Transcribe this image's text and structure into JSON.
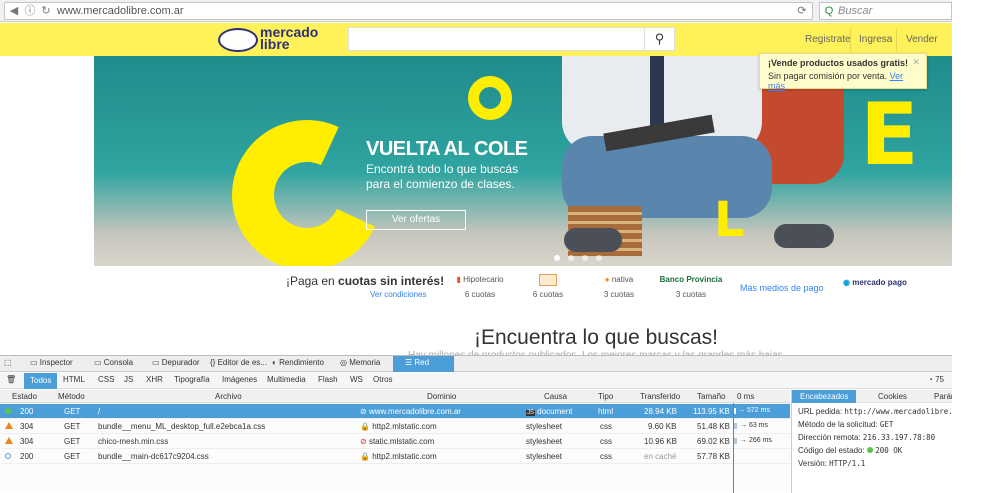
{
  "browser": {
    "url": "www.mercadolibre.com.ar",
    "search_placeholder": "Buscar"
  },
  "header": {
    "logo_line1": "mercado",
    "logo_line2": "libre",
    "links": [
      "Registrate",
      "Ingresa",
      "Vender"
    ]
  },
  "banner": {
    "title": "VUELTA AL COLE",
    "subtitle_line1": "Encontrá todo lo que buscás",
    "subtitle_line2": "para el comienzo de clases.",
    "button": "Ver ofertas"
  },
  "tooltip": {
    "title": "¡Vende productos usados gratis!",
    "text": "Sin pagar comisión por venta.",
    "link": "Ver más"
  },
  "payments": {
    "title_prefix": "¡Paga en ",
    "title_bold": "cuotas sin interés!",
    "link": "Ver condiciones",
    "banks": [
      {
        "name": "Hipotecario",
        "cuotas": "6 cuotas"
      },
      {
        "name": "",
        "cuotas": "6 cuotas"
      },
      {
        "name": "nativa",
        "cuotas": "3 cuotas"
      },
      {
        "name": "Banco Provincia",
        "cuotas": "3 cuotas"
      }
    ],
    "more": "Más medios de pago",
    "mpago": "mercado pago"
  },
  "section": {
    "title": "¡Encuentra lo que buscas!",
    "faded": "Hay millones de productos publicados. Los mejores marcas y las grandes más bajas"
  },
  "devtools": {
    "tabs": [
      "Inspector",
      "Consola",
      "Depurador",
      "Editor de es...",
      "Rendimiento",
      "Memoria",
      "Red"
    ],
    "filters": [
      "Todos",
      "HTML",
      "CSS",
      "JS",
      "XHR",
      "Tipografía",
      "Imágenes",
      "Multimedia",
      "Flash",
      "WS",
      "Otros"
    ],
    "request_count": "75",
    "columns": [
      "Estado",
      "Método",
      "Archivo",
      "Dominio",
      "Causa",
      "Tipo",
      "Transferido",
      "Tamaño",
      "0 ms"
    ],
    "rows": [
      {
        "status": "200",
        "method": "GET",
        "file": "/",
        "domain": "www.mercadolibre.com.ar",
        "cause": "document",
        "type": "html",
        "transferred": "28.94 KB",
        "size": "113.95 KB",
        "timing": "→ 572 ms"
      },
      {
        "status": "304",
        "method": "GET",
        "file": "bundle__menu_ML_desktop_full.e2ebca1a.css",
        "domain": "http2.mlstatic.com",
        "cause": "stylesheet",
        "type": "css",
        "transferred": "9.60 KB",
        "size": "51.48 KB",
        "timing": "→ 63 ms"
      },
      {
        "status": "304",
        "method": "GET",
        "file": "chico-mesh.min.css",
        "domain": "static.mlstatic.com",
        "cause": "stylesheet",
        "type": "css",
        "transferred": "10.96 KB",
        "size": "69.02 KB",
        "timing": "→ 266 ms"
      },
      {
        "status": "200",
        "method": "GET",
        "file": "bundle__main-dc617c9204.css",
        "domain": "http2.mlstatic.com",
        "cause": "stylesheet",
        "type": "css",
        "transferred": "en caché",
        "size": "57.78 KB",
        "timing": ""
      }
    ],
    "side_tabs": [
      "Encabezados",
      "Cookies",
      "Parár"
    ],
    "side": {
      "url_label": "URL pedida:",
      "url_value": "http://www.mercadolibre.com",
      "method_label": "Método de la solicitud:",
      "method_value": "GET",
      "remote_label": "Dirección remota:",
      "remote_value": "216.33.197.78:80",
      "status_label": "Código del estado:",
      "status_value": "200 OK",
      "version_label": "Versión:",
      "version_value": "HTTP/1.1"
    }
  },
  "colors": {
    "ml_yellow": "#fff159",
    "devtools_blue": "#4c9ed9",
    "link_blue": "#3483fa"
  }
}
